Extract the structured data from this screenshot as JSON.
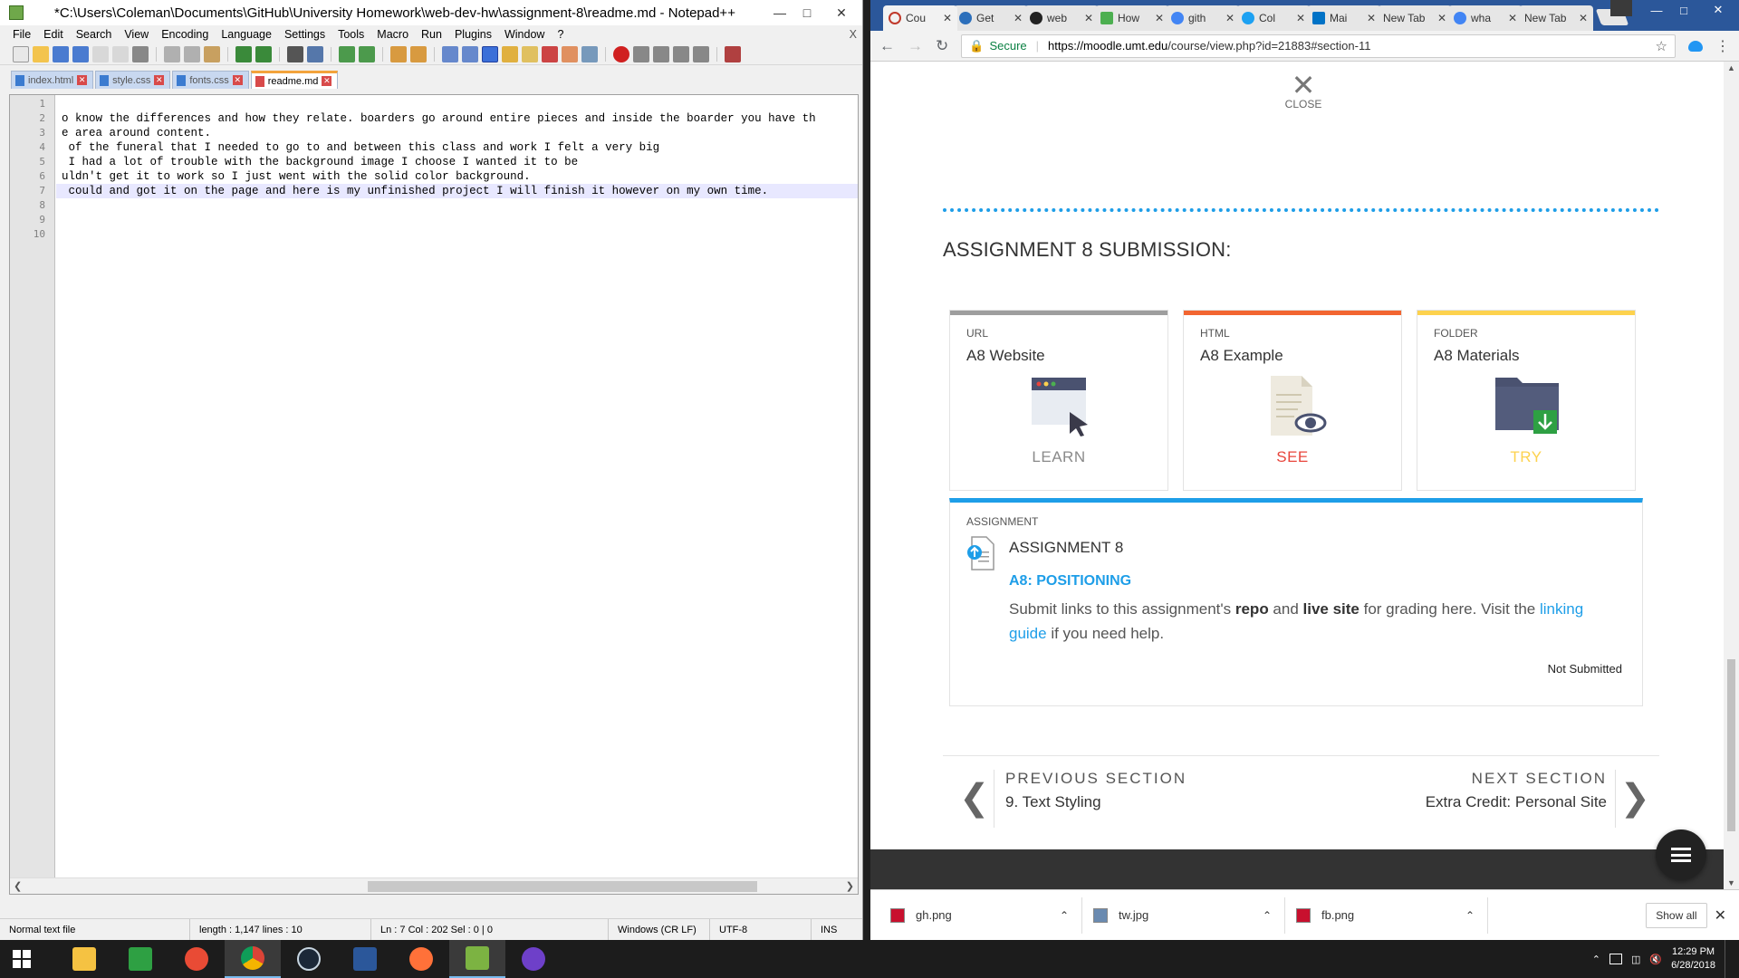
{
  "npp": {
    "title": "*C:\\Users\\Coleman\\Documents\\GitHub\\University Homework\\web-dev-hw\\assignment-8\\readme.md - Notepad++",
    "menu": [
      "File",
      "Edit",
      "Search",
      "View",
      "Encoding",
      "Language",
      "Settings",
      "Tools",
      "Macro",
      "Run",
      "Plugins",
      "Window",
      "?"
    ],
    "menu_close": "X",
    "tabs": [
      {
        "label": "index.html",
        "active": false
      },
      {
        "label": "style.css",
        "active": false
      },
      {
        "label": "fonts.css",
        "active": false
      },
      {
        "label": "readme.md",
        "active": true
      }
    ],
    "line_numbers": [
      "1",
      "2",
      "3",
      "4",
      "5",
      "6",
      "7",
      "8",
      "9",
      "10"
    ],
    "lines": [
      "",
      "o know the differences and how they relate. boarders go around entire pieces and inside the boarder you have th",
      "e area around content.",
      " of the funeral that I needed to go to and between this class and work I felt a very big",
      " I had a lot of trouble with the background image I choose I wanted it to be",
      "uldn't get it to work so I just went with the solid color background.",
      " could and got it on the page and here is my unfinished project I will finish it however on my own time.",
      "",
      "",
      ""
    ],
    "status": {
      "type": "Normal text file",
      "length": "length : 1,147    lines : 10",
      "pos": "Ln : 7    Col : 202    Sel : 0 | 0",
      "eol": "Windows (CR LF)",
      "enc": "UTF-8",
      "mode": "INS"
    }
  },
  "chrome": {
    "tabs": [
      {
        "label": "Cou",
        "color": "#c0392b"
      },
      {
        "label": "Get",
        "color": "#2c6fbb"
      },
      {
        "label": "web",
        "color": "#222222"
      },
      {
        "label": "How",
        "color": "#4caf50"
      },
      {
        "label": "gith",
        "color": "#4285f4"
      },
      {
        "label": "Col",
        "color": "#1da1f2"
      },
      {
        "label": "Mai",
        "color": "#0072c6"
      },
      {
        "label": "New Tab",
        "color": "#e6e6e6"
      },
      {
        "label": "wha",
        "color": "#4285f4"
      },
      {
        "label": "New Tab",
        "color": "#e6e6e6"
      }
    ],
    "secure_label": "Secure",
    "url_host": "https://moodle.umt.edu",
    "url_path": "/course/view.php?id=21883#section-11",
    "page": {
      "close_label": "CLOSE",
      "section_title": "ASSIGNMENT 8 SUBMISSION:",
      "cards": [
        {
          "type": "URL",
          "name": "A8 Website",
          "action": "LEARN",
          "color": "#9e9e9e",
          "action_color": "#8a8a8a"
        },
        {
          "type": "HTML",
          "name": "A8 Example",
          "action": "SEE",
          "color": "#f26531",
          "action_color": "#e8453c"
        },
        {
          "type": "FOLDER",
          "name": "A8 Materials",
          "action": "TRY",
          "color": "#fdd24e",
          "action_color": "#fdd24e"
        }
      ],
      "assignment": {
        "type": "ASSIGNMENT",
        "name": "ASSIGNMENT 8",
        "subtitle": "A8: POSITIONING",
        "desc_1": "Submit links to this assignment's ",
        "desc_bold1": "repo",
        "desc_2": " and ",
        "desc_bold2": "live site",
        "desc_3": " for grading here. Visit the ",
        "desc_link": "linking guide",
        "desc_4": " if you need help.",
        "status": "Not Submitted"
      },
      "prev_caption": "PREVIOUS SECTION",
      "prev_value": "9. Text Styling",
      "next_caption": "NEXT SECTION",
      "next_value": "Extra Credit: Personal Site"
    },
    "downloads": [
      {
        "name": "gh.png"
      },
      {
        "name": "tw.jpg"
      },
      {
        "name": "fb.png"
      }
    ],
    "show_all": "Show all"
  },
  "taskbar": {
    "apps": [
      {
        "name": "file-explorer",
        "color": "#f5c242",
        "active": false
      },
      {
        "name": "store",
        "color": "#2ea043",
        "active": false
      },
      {
        "name": "firefox-dev",
        "color": "#e94b35",
        "active": false
      },
      {
        "name": "chrome",
        "color": "#f2b90f",
        "active": true
      },
      {
        "name": "steam",
        "color": "#1b2838",
        "active": false
      },
      {
        "name": "word",
        "color": "#2b579a",
        "active": false
      },
      {
        "name": "firefox",
        "color": "#ff7139",
        "active": false
      },
      {
        "name": "notepad-plus-plus",
        "color": "#7cb342",
        "active": true
      },
      {
        "name": "github-desktop",
        "color": "#6e40c9",
        "active": false
      }
    ],
    "time": "12:29 PM",
    "date": "6/28/2018"
  }
}
